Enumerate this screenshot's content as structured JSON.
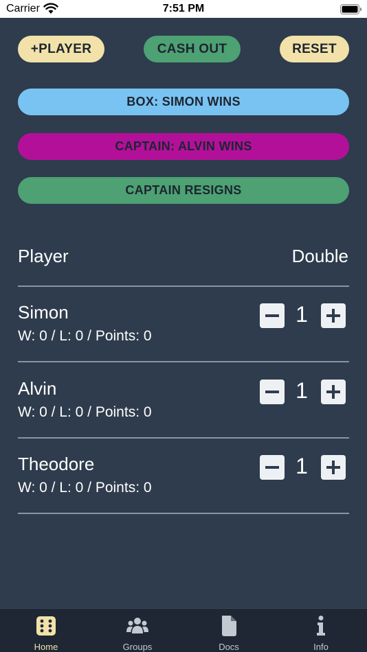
{
  "status_bar": {
    "carrier": "Carrier",
    "time": "7:51 PM"
  },
  "actions": {
    "add_player": "+PLAYER",
    "cash_out": "CASH OUT",
    "reset": "RESET",
    "box_wins": "BOX: SIMON WINS",
    "captain_wins": "CAPTAIN: ALVIN WINS",
    "captain_resigns": "CAPTAIN RESIGNS"
  },
  "colors": {
    "background": "#2e3c4d",
    "yellow": "#f2e2a9",
    "green": "#4da173",
    "blue": "#79c3f2",
    "magenta": "#b3109a"
  },
  "table": {
    "header_player": "Player",
    "header_double": "Double",
    "players": [
      {
        "name": "Simon",
        "stats": "W: 0 / L: 0 / Points: 0",
        "double": "1"
      },
      {
        "name": "Alvin",
        "stats": "W: 0 / L: 0 / Points: 0",
        "double": "1"
      },
      {
        "name": "Theodore",
        "stats": "W: 0 / L: 0 / Points: 0",
        "double": "1"
      }
    ]
  },
  "tabs": [
    {
      "label": "Home",
      "icon": "dice-icon",
      "active": true
    },
    {
      "label": "Groups",
      "icon": "users-icon",
      "active": false
    },
    {
      "label": "Docs",
      "icon": "document-icon",
      "active": false
    },
    {
      "label": "Info",
      "icon": "info-icon",
      "active": false
    }
  ]
}
